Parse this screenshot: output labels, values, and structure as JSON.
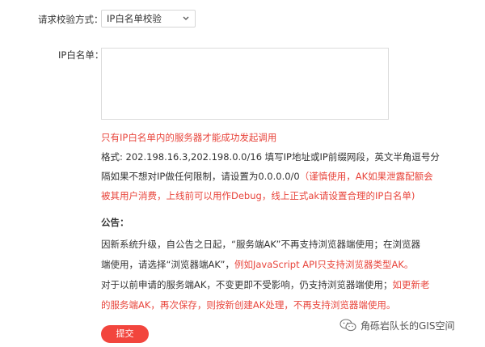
{
  "form": {
    "verify_label": "请求校验方式：",
    "verify_value": "IP白名单校验",
    "ip_label": "IP白名单：",
    "ip_value": ""
  },
  "hint": {
    "red_note": "只有IP白名单内的服务器才能成功发起调用",
    "format_line1": "格式: 202.198.16.3,202.198.0.0/16 填写IP地址或IP前缀网段，英文半角逗号分",
    "format_line2_a": "隔如果不想对IP做任何限制，请设置为0.0.0.0/0",
    "format_line2_b": "（谨慎使用，AK如果泄露配额会",
    "format_line3": "被其用户消费，上线前可以用作Debug，线上正式ak请设置合理的IP白名单)"
  },
  "notice": {
    "title": "公告：",
    "line1": "因新系统升级，自公告之日起，“服务端AK”不再支持浏览器端使用；在浏览器",
    "line2_a": "端使用，请选择“浏览器端AK”，",
    "line2_b": "例如JavaScript API只支持浏览器类型AK。",
    "line3_a": "对于以前申请的服务端AK，不变更即不受影响，仍支持浏览器端使用；",
    "line3_b": "如更新老",
    "line4": "的服务端AK，再次保存，则按新创建AK处理，不再支持浏览器端使用。"
  },
  "submit_label": "提交",
  "watermark": {
    "text": "角砾岩队长的GIS空间",
    "icon": "wechat-icon"
  }
}
